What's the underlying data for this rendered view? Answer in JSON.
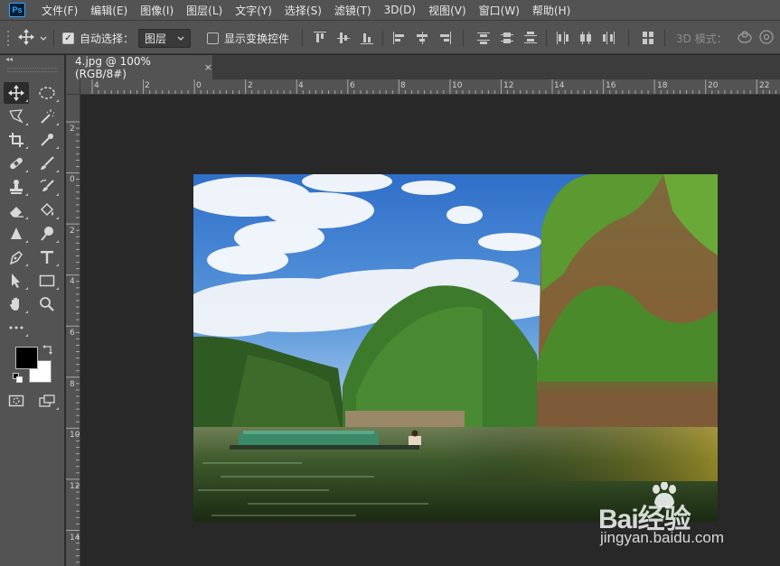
{
  "app": {
    "logo_text": "Ps"
  },
  "menu": [
    "文件(F)",
    "编辑(E)",
    "图像(I)",
    "图层(L)",
    "文字(Y)",
    "选择(S)",
    "滤镜(T)",
    "3D(D)",
    "视图(V)",
    "窗口(W)",
    "帮助(H)"
  ],
  "options_bar": {
    "auto_select_label": "自动选择：",
    "auto_select_checked": true,
    "auto_select_target": "图层",
    "show_transform_label": "显示变换控件",
    "show_transform_checked": false,
    "mode_3d_label": "3D 模式："
  },
  "document": {
    "tab_title": "4.jpg @ 100%(RGB/8#)",
    "close_glyph": "×"
  },
  "rulers": {
    "horizontal_labels": [
      "4",
      "2",
      "0",
      "2",
      "4",
      "6",
      "8",
      "10",
      "12",
      "14",
      "16",
      "18",
      "20",
      "22"
    ],
    "vertical_labels": [
      "2",
      "0",
      "2",
      "4",
      "6",
      "8",
      "10",
      "12",
      "14"
    ]
  },
  "tools": [
    "move-tool",
    "marquee-tool",
    "lasso-tool",
    "magic-wand-tool",
    "crop-tool",
    "eyedropper-tool",
    "healing-brush-tool",
    "brush-tool",
    "clone-stamp-tool",
    "history-brush-tool",
    "eraser-tool",
    "paint-bucket-tool",
    "blur-tool",
    "dodge-tool",
    "pen-tool",
    "type-tool",
    "path-selection-tool",
    "rectangle-tool",
    "hand-tool",
    "zoom-tool"
  ],
  "colors": {
    "foreground": "#000000",
    "background": "#ffffff",
    "ui_panel": "#535353",
    "canvas_bg": "#282828"
  },
  "watermark": {
    "brand": "Bai经验",
    "url": "jingyan.baidu.com"
  }
}
